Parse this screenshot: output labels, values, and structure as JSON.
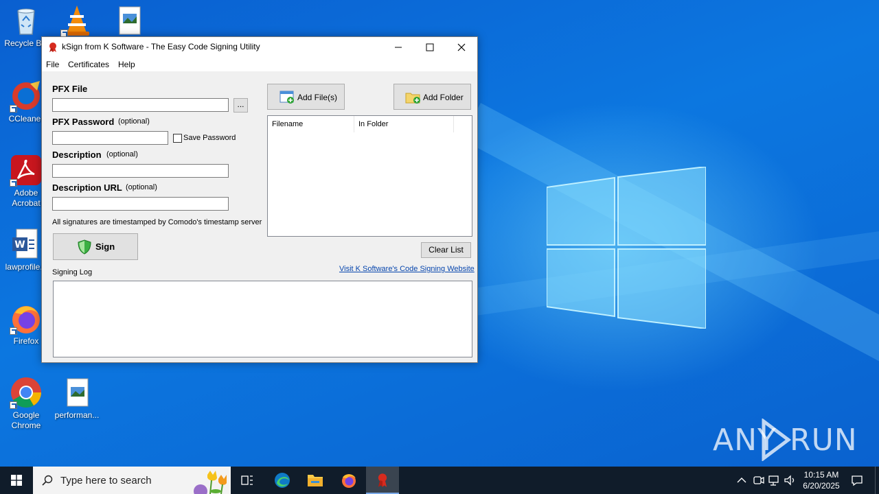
{
  "desktop": {
    "icons": [
      {
        "label": "Recycle Bin"
      },
      {
        "label": ""
      },
      {
        "label": ""
      },
      {
        "label": "CCleaner"
      },
      {
        "label": "Adobe Acrobat"
      },
      {
        "label": "lawprofile..."
      },
      {
        "label": "Firefox"
      },
      {
        "label": "Google Chrome"
      },
      {
        "label": "performan..."
      }
    ],
    "watermark": {
      "left": "ANY",
      "right": "RUN"
    }
  },
  "window": {
    "title": "kSign from K Software - The Easy Code Signing Utility",
    "menu": [
      "File",
      "Certificates",
      "Help"
    ],
    "pfx_file": {
      "label": "PFX File",
      "value": "",
      "browse_label": "..."
    },
    "pfx_password": {
      "label": "PFX Password",
      "optional": "(optional)",
      "value": "",
      "save_label": "Save Password",
      "save_checked": false
    },
    "description": {
      "label": "Description",
      "optional": "(optional)",
      "value": ""
    },
    "description_url": {
      "label": "Description URL",
      "optional": "(optional)",
      "value": ""
    },
    "timestamp_note": "All signatures are timestamped by Comodo's timestamp server",
    "sign_label": "Sign",
    "add_files_label": "Add File(s)",
    "add_folder_label": "Add Folder",
    "columns": [
      "Filename",
      "In Folder"
    ],
    "clear_list_label": "Clear List",
    "website_link": "Visit K Software's Code Signing Website",
    "signing_log_label": "Signing Log"
  },
  "taskbar": {
    "search_placeholder": "Type here to search",
    "time": "10:15 AM",
    "date": "6/20/2025"
  },
  "colors": {
    "desktop_blue": "#0a6fd4",
    "taskbar": "#101c2a",
    "link": "#0645ad"
  }
}
